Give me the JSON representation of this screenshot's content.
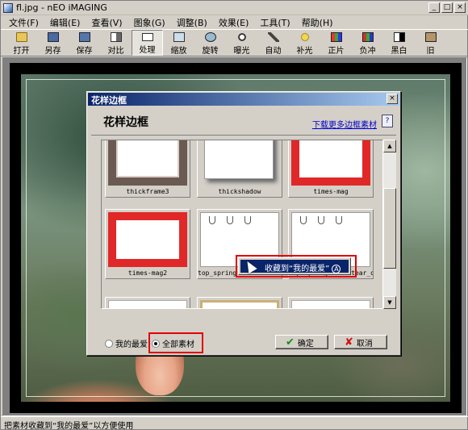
{
  "window": {
    "title": "fl.jpg - nEO iMAGING",
    "minimize_glyph": "_",
    "maximize_glyph": "□",
    "close_glyph": "×"
  },
  "menu": [
    {
      "label": "文件(F)"
    },
    {
      "label": "编辑(E)"
    },
    {
      "label": "查看(V)"
    },
    {
      "label": "图象(G)"
    },
    {
      "label": "调整(B)"
    },
    {
      "label": "效果(E)"
    },
    {
      "label": "工具(T)"
    },
    {
      "label": "帮助(H)"
    }
  ],
  "toolbar": [
    {
      "label": "打开",
      "icon": "folder-icon"
    },
    {
      "label": "另存",
      "icon": "save-as-icon"
    },
    {
      "label": "保存",
      "icon": "save-icon"
    },
    {
      "label": "对比",
      "icon": "compare-icon"
    },
    {
      "label": "处理",
      "icon": "process-icon",
      "active": true
    },
    {
      "label": "缩放",
      "icon": "zoom-icon"
    },
    {
      "label": "旋转",
      "icon": "rotate-icon"
    },
    {
      "label": "曝光",
      "icon": "exposure-icon"
    },
    {
      "label": "自动",
      "icon": "auto-icon"
    },
    {
      "label": "补光",
      "icon": "fill-light-icon"
    },
    {
      "label": "正片",
      "icon": "positive-film-icon"
    },
    {
      "label": "负冲",
      "icon": "negative-film-icon"
    },
    {
      "label": "黑白",
      "icon": "black-white-icon"
    },
    {
      "label": "旧",
      "icon": "old-photo-icon"
    }
  ],
  "dialog": {
    "title": "花样边框",
    "header": "花样边框",
    "download_link": "下载更多边框素材",
    "close_glyph": "×",
    "thumbnails": [
      {
        "label": "thickframe3",
        "style": "ornate"
      },
      {
        "label": "thickshadow",
        "style": "shadow"
      },
      {
        "label": "times-mag",
        "style": "red"
      },
      {
        "label": "times-mag2",
        "style": "red"
      },
      {
        "label": "top_spring_note_tear_off",
        "style": "spiral"
      },
      {
        "label": "top_spring_note_tear_off_h",
        "style": "spiral"
      },
      {
        "label": "",
        "style": "plain"
      },
      {
        "label": "",
        "style": "scroll"
      },
      {
        "label": "",
        "style": "plain"
      }
    ],
    "context_menu": {
      "label": "收藏到“我的最爱”",
      "hotkey": "A"
    },
    "radio_favorites": "我的最爱",
    "radio_all": "全部素材",
    "ok_label": "确定",
    "cancel_label": "取消"
  },
  "status": "把素材收藏到“我的最爱”以方便使用"
}
